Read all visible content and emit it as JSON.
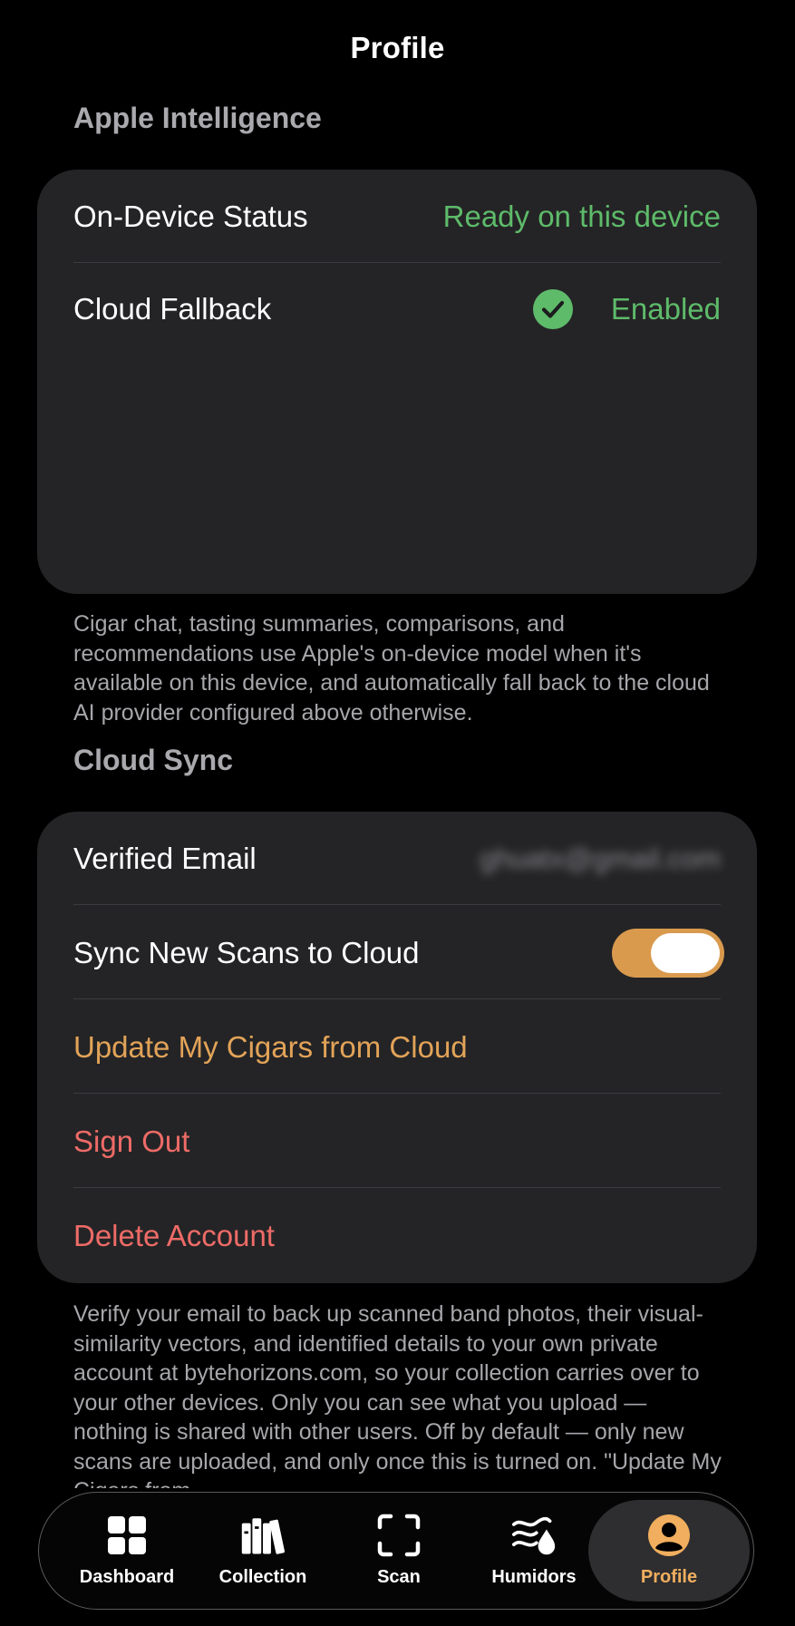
{
  "header": {
    "title": "Profile"
  },
  "apple_intelligence": {
    "section_title": "Apple Intelligence",
    "rows": {
      "status_label": "On-Device Status",
      "status_value": "Ready on this device",
      "fallback_label": "Cloud Fallback",
      "fallback_value": "Enabled",
      "fallback_icon": "checkmark-circle-icon"
    },
    "footnote": "Cigar chat, tasting summaries, comparisons, and recommendations use Apple's on-device model when it's available on this device, and automatically fall back to the cloud AI provider configured above otherwise."
  },
  "cloud_sync": {
    "section_title": "Cloud Sync",
    "email_label": "Verified Email",
    "email_value": "ghuatx@gmail.com",
    "sync_label": "Sync New Scans to Cloud",
    "sync_enabled": true,
    "update_label": "Update My Cigars from Cloud",
    "sign_out_label": "Sign Out",
    "delete_label": "Delete Account",
    "footnote": "Verify your email to back up scanned band photos, their visual-similarity vectors, and identified details to your own private account at bytehorizons.com, so your collection carries over to your other devices. Only you can see what you upload — nothing is shared with other users. Off by default — only new scans are uploaded, and only once this is turned on. \"Update My Cigars from"
  },
  "tabbar": {
    "tabs": [
      {
        "label": "Dashboard",
        "icon": "dashboard-grid-icon"
      },
      {
        "label": "Collection",
        "icon": "books-icon"
      },
      {
        "label": "Scan",
        "icon": "scan-frame-icon"
      },
      {
        "label": "Humidors",
        "icon": "humidity-icon"
      },
      {
        "label": "Profile",
        "icon": "profile-icon"
      }
    ],
    "active": "Profile"
  },
  "colors": {
    "background": "#000000",
    "card": "#242426",
    "green": "#5ebb6a",
    "accent_orange": "#e2a358",
    "destructive_red": "#ee6b67"
  }
}
